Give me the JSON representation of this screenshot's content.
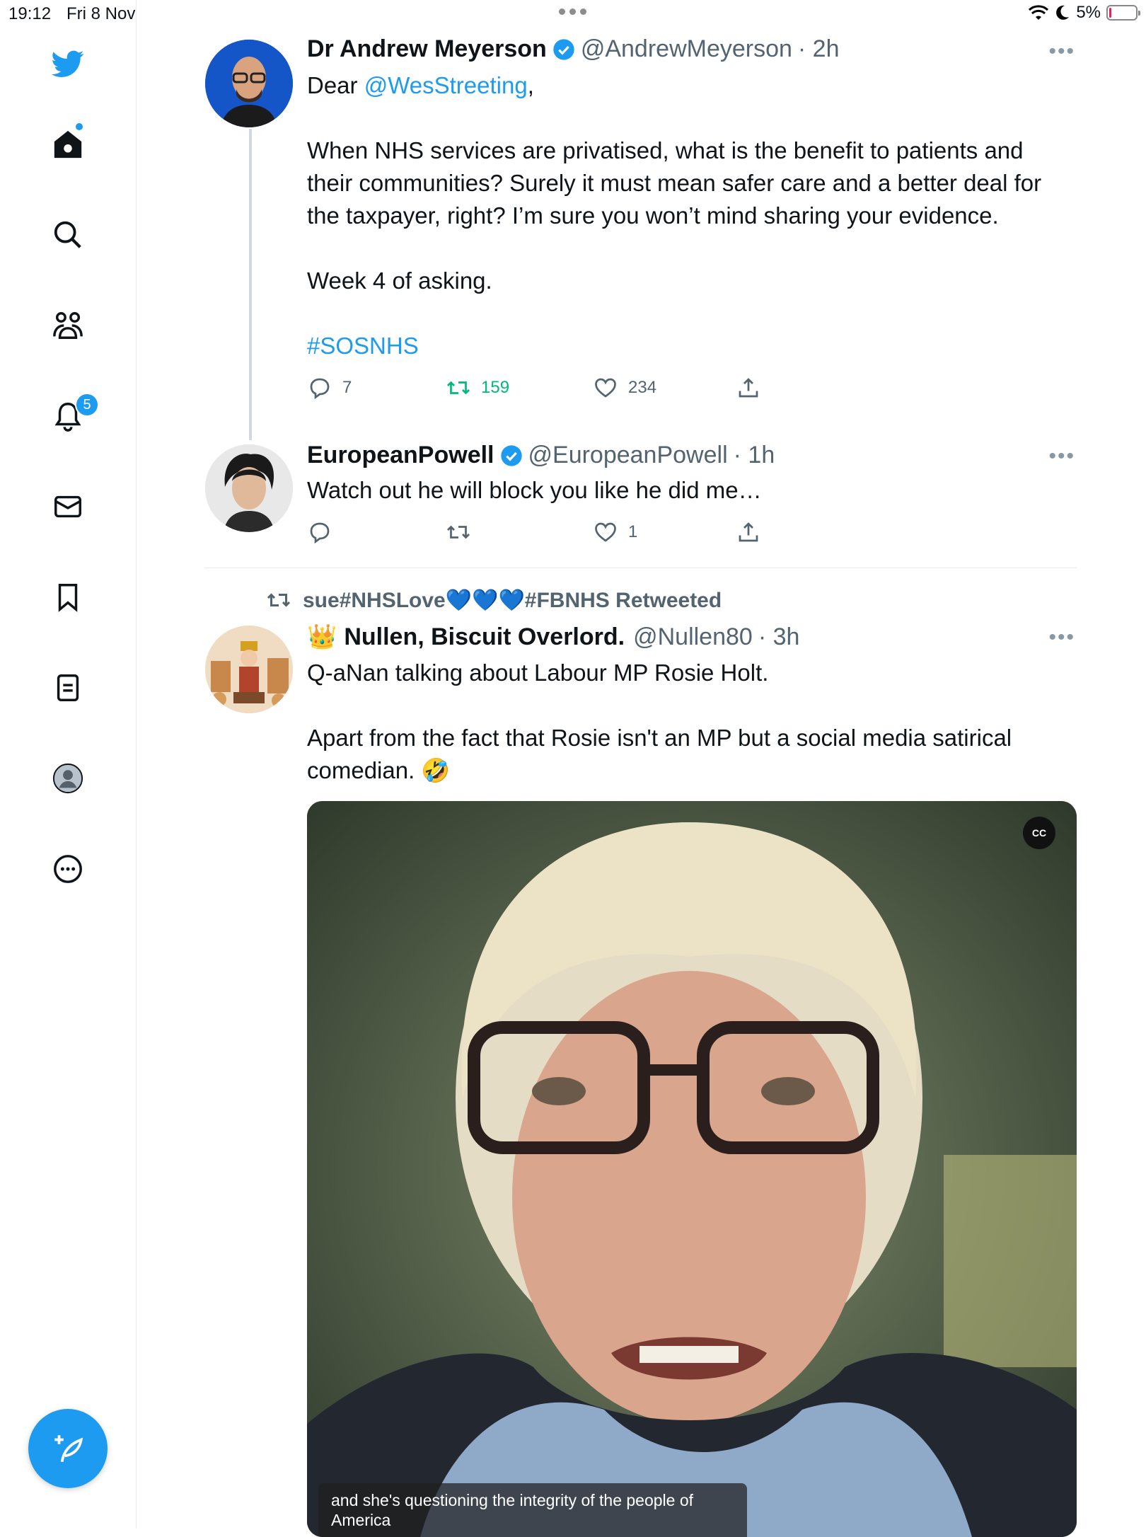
{
  "status_bar": {
    "time": "19:12",
    "date": "Fri 8 Nov",
    "battery": "5%",
    "battery_level": 0.05
  },
  "sidebar": {
    "icons": [
      "twitter-logo-icon",
      "home-icon",
      "search-icon",
      "communities-icon",
      "notifications-icon",
      "messages-icon",
      "bookmarks-icon",
      "lists-icon",
      "profile-icon",
      "more-icon"
    ],
    "notifications_badge": "5"
  },
  "tweets": [
    {
      "name": "Dr Andrew Meyerson",
      "handle": "@AndrewMeyerson",
      "time": "· 2h",
      "text_prefix": "Dear ",
      "mention": "@WesStreeting",
      "text_suffix": ",",
      "paragraph_1": "When NHS services are privatised, what is the benefit to patients and their communities? Surely it must mean safer care and a better deal for the taxpayer, right? I’m sure you won’t mind sharing your evidence.",
      "paragraph_2": "Week 4 of asking.",
      "hashtag": "#SOSNHS",
      "replies": "7",
      "retweets": "159",
      "likes": "234"
    },
    {
      "name": "EuropeanPowell",
      "handle": "@EuropeanPowell",
      "time": "· 1h",
      "text": "Watch out he will block you like he did me…",
      "replies": "",
      "retweets": "",
      "likes": "1"
    },
    {
      "retweeted_by": "sue#NHSLove💙💙💙#FBNHS Retweeted",
      "crown": "👑",
      "name": "Nullen, Biscuit Overlord.",
      "handle": "@Nullen80",
      "time": "· 3h",
      "paragraph_1": "Q-aNan talking about Labour MP Rosie Holt.",
      "paragraph_2": "Apart from the fact that Rosie isn't an MP but a social media satirical comedian. 🤣",
      "video_caption": "and she's questioning the integrity of the people of America",
      "cc_label": "CC"
    }
  ],
  "colors": {
    "accent": "#1d9bf0",
    "retweet_green": "#00ba7c",
    "secondary_text": "#536471"
  }
}
